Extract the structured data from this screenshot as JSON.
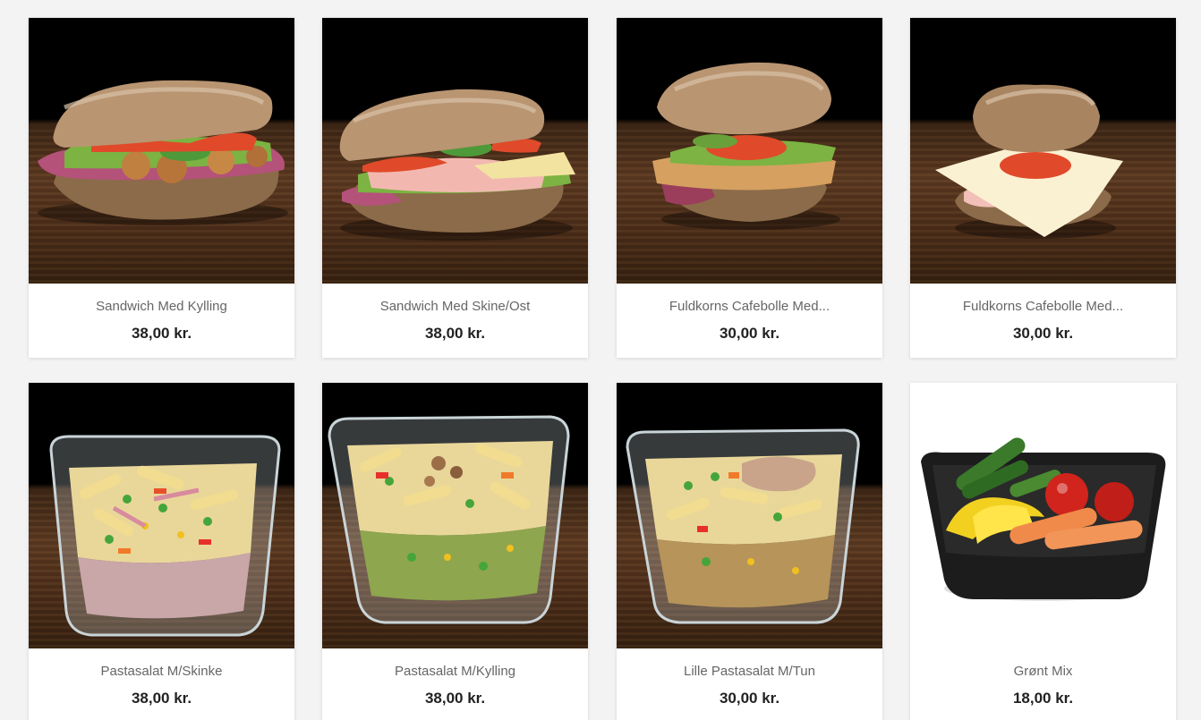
{
  "products": [
    {
      "name": "Sandwich Med Kylling",
      "price": "38,00 kr.",
      "image": "sandwich-chicken-image"
    },
    {
      "name": "Sandwich Med Skine/Ost",
      "price": "38,00 kr.",
      "image": "sandwich-ham-cheese-image"
    },
    {
      "name": "Fuldkorns Cafebolle Med...",
      "price": "30,00 kr.",
      "image": "wholegrain-bun-chicken-image"
    },
    {
      "name": "Fuldkorns Cafebolle Med...",
      "price": "30,00 kr.",
      "image": "wholegrain-bun-cheese-image"
    },
    {
      "name": "Pastasalat M/Skinke",
      "price": "38,00 kr.",
      "image": "pasta-salad-ham-image"
    },
    {
      "name": "Pastasalat M/Kylling",
      "price": "38,00 kr.",
      "image": "pasta-salad-chicken-image"
    },
    {
      "name": "Lille Pastasalat M/Tun",
      "price": "30,00 kr.",
      "image": "small-pasta-salad-tuna-image"
    },
    {
      "name": "Grønt Mix",
      "price": "18,00 kr.",
      "image": "green-mix-vegetables-image"
    }
  ]
}
